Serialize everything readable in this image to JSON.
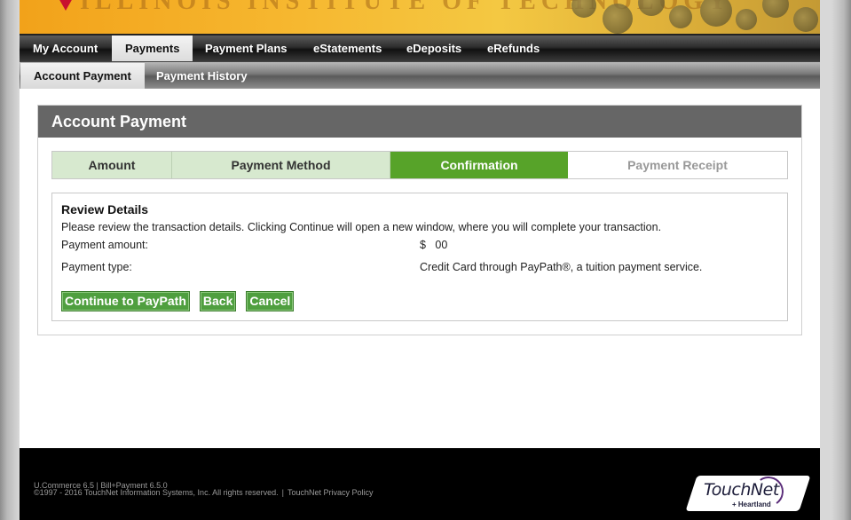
{
  "banner": {
    "text": "ILLINOIS INSTITUTE OF TECHNOLOGY"
  },
  "nav": {
    "primary": [
      {
        "label": "My Account"
      },
      {
        "label": "Payments"
      },
      {
        "label": "Payment Plans"
      },
      {
        "label": "eStatements"
      },
      {
        "label": "eDeposits"
      },
      {
        "label": "eRefunds"
      }
    ],
    "primary_active": "Payments",
    "secondary": [
      {
        "label": "Account Payment"
      },
      {
        "label": "Payment History"
      }
    ],
    "secondary_active": "Account Payment"
  },
  "panel": {
    "title": "Account Payment",
    "steps": [
      {
        "label": "Amount",
        "state": "done"
      },
      {
        "label": "Payment Method",
        "state": "done"
      },
      {
        "label": "Confirmation",
        "state": "current"
      },
      {
        "label": "Payment Receipt",
        "state": "future"
      }
    ],
    "review": {
      "heading": "Review Details",
      "instructions": "Please review the transaction details. Clicking Continue will open a new window, where you will complete your transaction.",
      "amount_label": "Payment amount:",
      "amount_value": "$   00",
      "type_label": "Payment type:",
      "type_value": "Credit Card through PayPath®, a tuition payment service."
    },
    "buttons": {
      "continue": "Continue to PayPath",
      "back": "Back",
      "cancel": "Cancel"
    }
  },
  "footer": {
    "version": "U.Commerce 6.5 | Bill+Payment 6.5.0",
    "copyright": "©1997 - 2016  TouchNet Information Systems, Inc. All rights reserved.",
    "separator": "|",
    "privacy_link": "TouchNet Privacy Policy",
    "logo_text": "TouchNet",
    "logo_sub": "+ Heartland"
  },
  "colors": {
    "step_done": "#d7e9cf",
    "step_current": "#57a329",
    "button_green": "#4f9f3f",
    "panel_header": "#666666"
  }
}
